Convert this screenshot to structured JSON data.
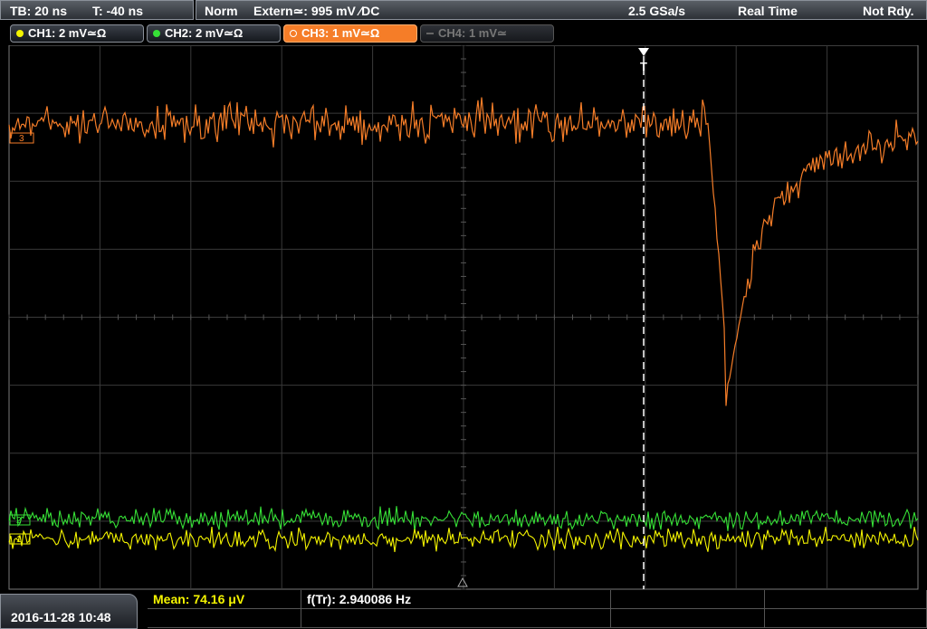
{
  "topbar": {
    "timebase": "TB: 20 ns",
    "trigger_time": "T: -40 ns",
    "acq_mode": "Norm",
    "trigger_source": "Extern≃: 995 mV ∕DC",
    "sample_rate": "2.5 GSa/s",
    "realtime": "Real Time",
    "status": "Not Rdy."
  },
  "channels": [
    {
      "label": "CH1: 2 mV≃Ω",
      "color": "#f4f400",
      "state": "on"
    },
    {
      "label": "CH2: 2 mV≃Ω",
      "color": "#36e036",
      "state": "on"
    },
    {
      "label": "CH3: 1 mV≃Ω",
      "color": "#f57d28",
      "state": "selected"
    },
    {
      "label": "CH4: 1 mV≃",
      "color": "#777777",
      "state": "off"
    }
  ],
  "trigger_marker": "T",
  "ch3_marker": "3",
  "ch2_marker": "2",
  "ch1_marker": "1",
  "footer": {
    "datetime": "2016-11-28 10:48",
    "mean": "Mean: 74.16 μV",
    "freq": "f(Tr): 2.940086 Hz"
  },
  "colors": {
    "ch1": "#f4f400",
    "ch2": "#36e036",
    "ch3": "#f57d28",
    "grid": "#3a3a3a",
    "trigger_line": "#ffffff"
  }
}
